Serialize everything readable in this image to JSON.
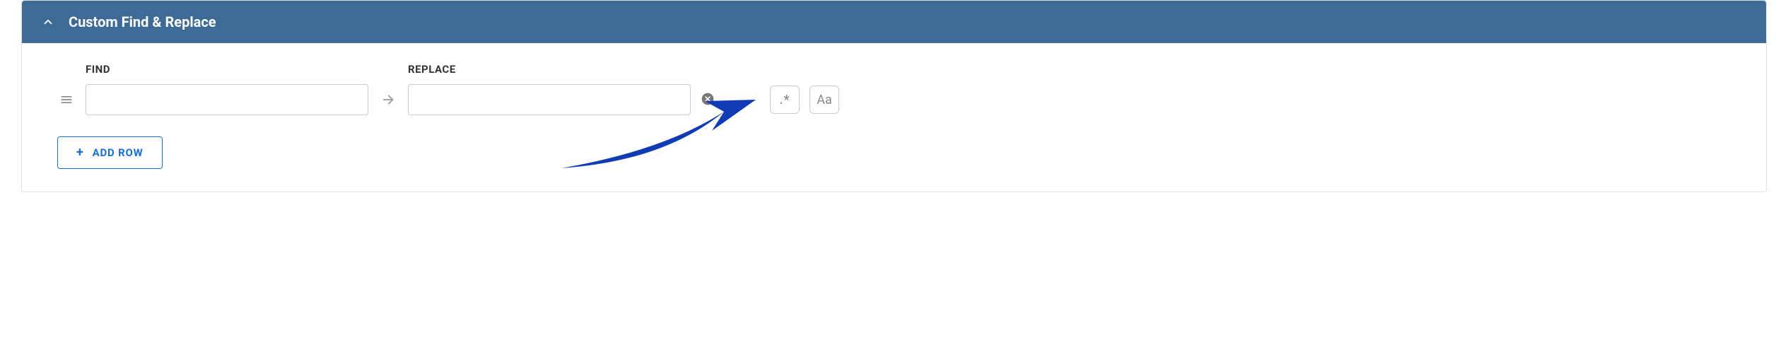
{
  "header": {
    "title": "Custom Find & Replace"
  },
  "labels": {
    "find": "FIND",
    "replace": "REPLACE"
  },
  "row": {
    "find_value": "",
    "replace_value": ""
  },
  "toggles": {
    "regex": ".*",
    "case": "Aa"
  },
  "buttons": {
    "add_row": "ADD ROW"
  }
}
